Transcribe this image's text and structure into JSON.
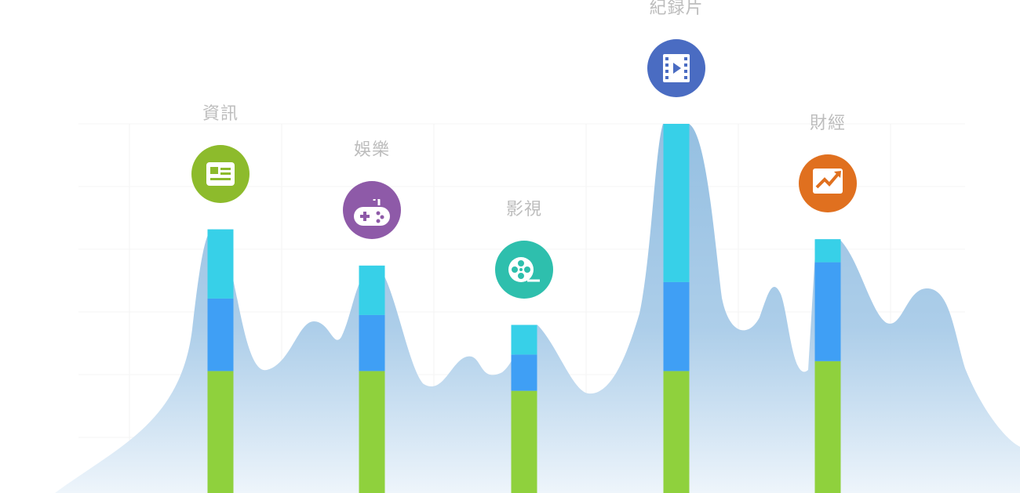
{
  "chart_data": {
    "type": "bar",
    "stacked": true,
    "grid": true,
    "categories": [
      "資訊",
      "娛樂",
      "影視",
      "紀録片",
      "財經"
    ],
    "series": [
      {
        "color": "#8fd13d",
        "values": [
          37,
          37,
          31,
          37,
          40
        ]
      },
      {
        "color": "#3f9ff5",
        "values": [
          22,
          17,
          11,
          27,
          30
        ]
      },
      {
        "color": "#37d0e8",
        "values": [
          21,
          15,
          9,
          48,
          7
        ]
      }
    ],
    "ylim": [
      0,
      112
    ],
    "background_area": {
      "color": "#8fbce0"
    }
  },
  "category_icons": [
    {
      "icon": "news-icon",
      "color": "#8dbb2c"
    },
    {
      "icon": "gamepad-icon",
      "color": "#8e5aa8"
    },
    {
      "icon": "film-reel-icon",
      "color": "#2ebfad"
    },
    {
      "icon": "video-icon",
      "color": "#4a6cc2"
    },
    {
      "icon": "trend-chart-icon",
      "color": "#e0701f"
    }
  ]
}
